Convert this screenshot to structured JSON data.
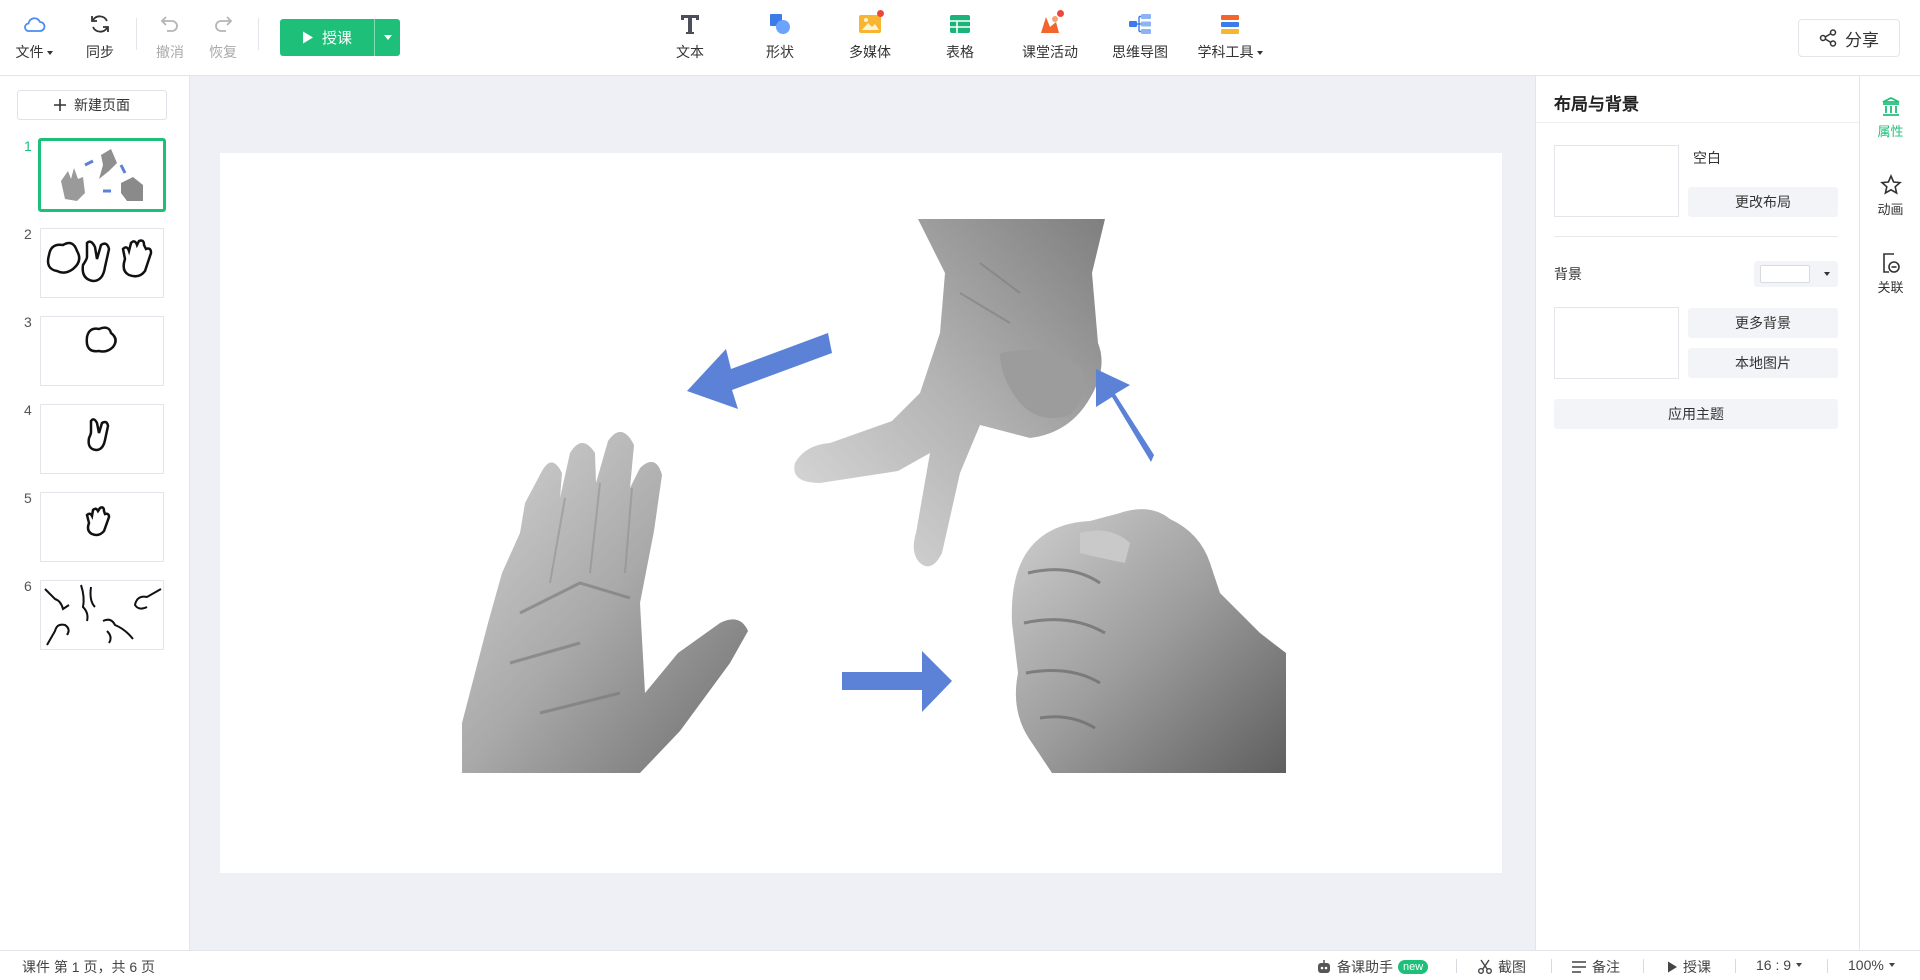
{
  "toolbar": {
    "file": "文件",
    "sync": "同步",
    "undo": "撤消",
    "redo": "恢复",
    "teach": "授课",
    "insert": [
      {
        "label": "文本",
        "icon": "text-icon"
      },
      {
        "label": "形状",
        "icon": "shape-icon"
      },
      {
        "label": "多媒体",
        "icon": "media-icon"
      },
      {
        "label": "表格",
        "icon": "table-icon"
      },
      {
        "label": "课堂活动",
        "icon": "class-activity-icon"
      },
      {
        "label": "思维导图",
        "icon": "mindmap-icon"
      },
      {
        "label": "学科工具",
        "icon": "subject-tools-icon"
      }
    ],
    "share": "分享"
  },
  "left_panel": {
    "new_page": "新建页面",
    "pages": [
      "1",
      "2",
      "3",
      "4",
      "5",
      "6"
    ],
    "active_page": 1
  },
  "right_panel": {
    "title": "布局与背景",
    "layout_name": "空白",
    "change_layout": "更改布局",
    "background_label": "背景",
    "background_color": "#ffffff",
    "more_backgrounds": "更多背景",
    "local_image": "本地图片",
    "apply_theme": "应用主题"
  },
  "side_tabs": [
    "属性",
    "动画",
    "关联"
  ],
  "status": {
    "page_info": "课件 第 1 页，共 6 页",
    "assistant": "备课助手",
    "assistant_badge": "new",
    "screenshot": "截图",
    "notes": "备注",
    "teach": "授课",
    "ratio": "16 : 9",
    "zoom": "100%"
  },
  "colors": {
    "accent": "#1ec079",
    "arrow_blue": "#5b82d6"
  }
}
